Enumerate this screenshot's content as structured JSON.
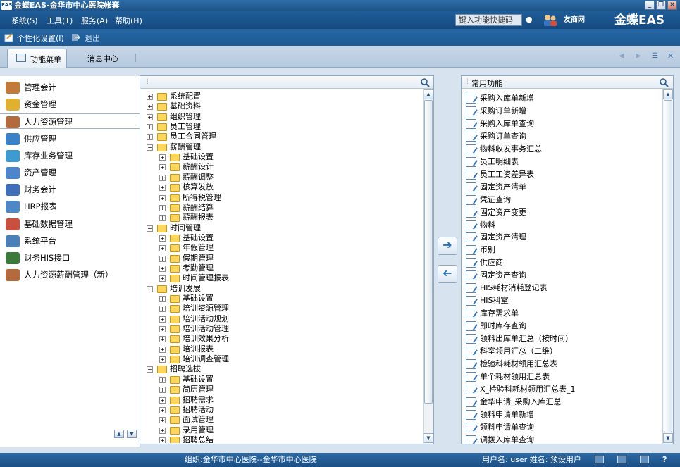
{
  "window": {
    "logo_text": "EAS",
    "title": "金蝶EAS-金华市中心医院帐套",
    "minimize": "_",
    "restore": "❐",
    "close": "✕"
  },
  "menu": {
    "items": [
      "系统(S)",
      "工具(T)",
      "服务(A)",
      "帮助(H)"
    ],
    "shortcut_placeholder": "键入功能快捷码",
    "kingdee_logo": "友商网",
    "eas_logo": "金蝶EAS"
  },
  "toolbar": {
    "personal_settings": "个性化设置(I)",
    "logout": "退出"
  },
  "tabs": {
    "function_menu": "功能菜单",
    "message_center": "消息中心"
  },
  "nav": {
    "items": [
      {
        "label": "管理会计",
        "color": "#c27a3a"
      },
      {
        "label": "资金管理",
        "color": "#e0b030"
      },
      {
        "label": "人力资源管理",
        "color": "#b36a3c"
      },
      {
        "label": "供应管理",
        "color": "#3a82c8"
      },
      {
        "label": "库存业务管理",
        "color": "#3f9ad0"
      },
      {
        "label": "资产管理",
        "color": "#4d86c9"
      },
      {
        "label": "财务会计",
        "color": "#3f6fb8"
      },
      {
        "label": "HRP报表",
        "color": "#4f86c5"
      },
      {
        "label": "基础数据管理",
        "color": "#c94f3f"
      },
      {
        "label": "系统平台",
        "color": "#4a7fb8"
      },
      {
        "label": "财务HIS接口",
        "color": "#3c7a3c"
      },
      {
        "label": "人力资源薪酬管理（新）",
        "color": "#b36a3c"
      }
    ],
    "selected_index": 2
  },
  "tree": {
    "rows": [
      {
        "label": "系统配置",
        "level": 0,
        "expanded": false
      },
      {
        "label": "基础资料",
        "level": 0,
        "expanded": false
      },
      {
        "label": "组织管理",
        "level": 0,
        "expanded": false
      },
      {
        "label": "员工管理",
        "level": 0,
        "expanded": false
      },
      {
        "label": "员工合同管理",
        "level": 0,
        "expanded": false
      },
      {
        "label": "薪酬管理",
        "level": 0,
        "expanded": true
      },
      {
        "label": "基础设置",
        "level": 1,
        "expanded": false
      },
      {
        "label": "薪酬设计",
        "level": 1,
        "expanded": false
      },
      {
        "label": "薪酬调整",
        "level": 1,
        "expanded": false
      },
      {
        "label": "核算发放",
        "level": 1,
        "expanded": false
      },
      {
        "label": "所得税管理",
        "level": 1,
        "expanded": false
      },
      {
        "label": "薪酬结算",
        "level": 1,
        "expanded": false
      },
      {
        "label": "薪酬报表",
        "level": 1,
        "expanded": false
      },
      {
        "label": "时间管理",
        "level": 0,
        "expanded": true
      },
      {
        "label": "基础设置",
        "level": 1,
        "expanded": false
      },
      {
        "label": "年假管理",
        "level": 1,
        "expanded": false
      },
      {
        "label": "假期管理",
        "level": 1,
        "expanded": false
      },
      {
        "label": "考勤管理",
        "level": 1,
        "expanded": false
      },
      {
        "label": "时间管理报表",
        "level": 1,
        "expanded": false
      },
      {
        "label": "培训发展",
        "level": 0,
        "expanded": true
      },
      {
        "label": "基础设置",
        "level": 1,
        "expanded": false
      },
      {
        "label": "培训资源管理",
        "level": 1,
        "expanded": false
      },
      {
        "label": "培训活动规划",
        "level": 1,
        "expanded": false
      },
      {
        "label": "培训活动管理",
        "level": 1,
        "expanded": false
      },
      {
        "label": "培训效果分析",
        "level": 1,
        "expanded": false
      },
      {
        "label": "培训报表",
        "level": 1,
        "expanded": false
      },
      {
        "label": "培训调查管理",
        "level": 1,
        "expanded": false
      },
      {
        "label": "招聘选拔",
        "level": 0,
        "expanded": true
      },
      {
        "label": "基础设置",
        "level": 1,
        "expanded": false
      },
      {
        "label": "简历管理",
        "level": 1,
        "expanded": false
      },
      {
        "label": "招聘需求",
        "level": 1,
        "expanded": false
      },
      {
        "label": "招聘活动",
        "level": 1,
        "expanded": false
      },
      {
        "label": "面试管理",
        "level": 1,
        "expanded": false
      },
      {
        "label": "录用管理",
        "level": 1,
        "expanded": false
      },
      {
        "label": "招聘总结",
        "level": 1,
        "expanded": false
      }
    ]
  },
  "favorites": {
    "title": "常用功能",
    "items": [
      "采购入库单新增",
      "采购订单新增",
      "采购入库单查询",
      "采购订单查询",
      "物料收发事务汇总",
      "员工明细表",
      "员工工资差异表",
      "固定资产清单",
      "凭证查询",
      "固定资产变更",
      "物料",
      "固定资产清理",
      "币别",
      "供应商",
      "固定资产查询",
      "HIS耗材消耗登记表",
      "HIS科室",
      "库存需求单",
      "即时库存查询",
      "领料出库单汇总（按时间）",
      "科室领用汇总（二维）",
      "检验科耗材领用汇总表",
      "单个耗材领用汇总表",
      "X_检验科耗材领用汇总表_1",
      "金华申请_采购入库汇总",
      "领料申请单新增",
      "领料申请单查询",
      "调拨入库单查询"
    ]
  },
  "status": {
    "org": "组织:金华市中心医院--金华市中心医院",
    "user": "用户名: user 姓名: 预设用户",
    "help": "?"
  }
}
